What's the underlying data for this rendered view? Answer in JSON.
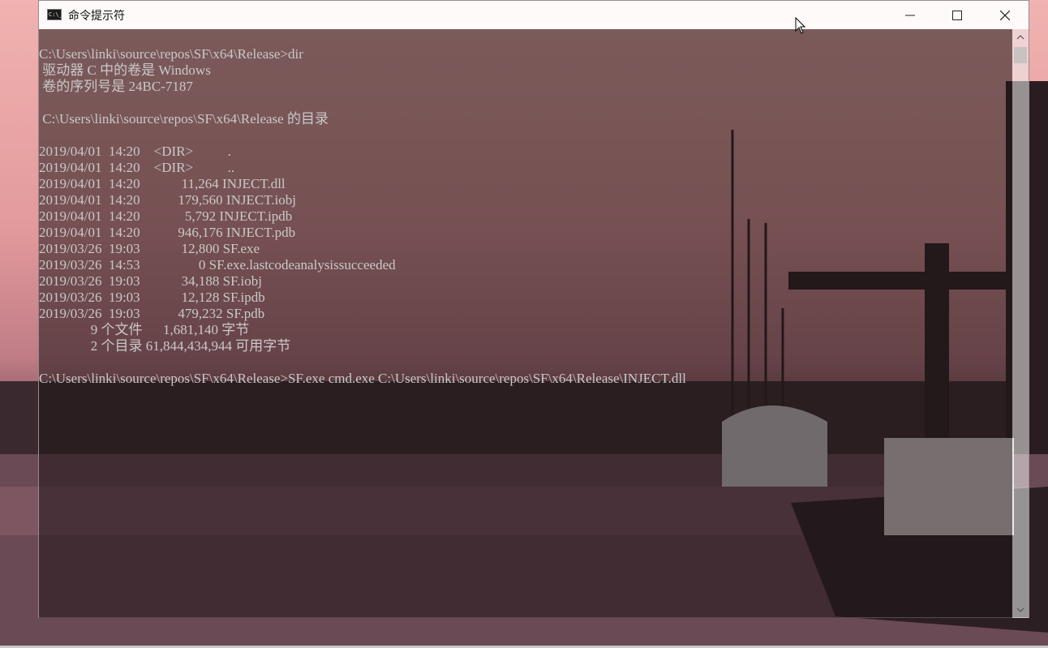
{
  "window": {
    "title": "命令提示符",
    "icon": "cmd-icon",
    "icon_text": "C:\\_"
  },
  "controls": {
    "minimize_icon": "minimize-icon",
    "maximize_icon": "maximize-icon",
    "close_icon": "close-icon"
  },
  "console": {
    "lines": [
      "C:\\Users\\linki\\source\\repos\\SF\\x64\\Release>dir",
      " 驱动器 C 中的卷是 Windows",
      " 卷的序列号是 24BC-7187",
      "",
      " C:\\Users\\linki\\source\\repos\\SF\\x64\\Release 的目录",
      "",
      "2019/04/01  14:20    <DIR>          .",
      "2019/04/01  14:20    <DIR>          ..",
      "2019/04/01  14:20            11,264 INJECT.dll",
      "2019/04/01  14:20           179,560 INJECT.iobj",
      "2019/04/01  14:20             5,792 INJECT.ipdb",
      "2019/04/01  14:20           946,176 INJECT.pdb",
      "2019/03/26  19:03            12,800 SF.exe",
      "2019/03/26  14:53                 0 SF.exe.lastcodeanalysissucceeded",
      "2019/03/26  19:03            34,188 SF.iobj",
      "2019/03/26  19:03            12,128 SF.ipdb",
      "2019/03/26  19:03           479,232 SF.pdb",
      "               9 个文件      1,681,140 字节",
      "               2 个目录 61,844,434,944 可用字节",
      "",
      "C:\\Users\\linki\\source\\repos\\SF\\x64\\Release>SF.exe cmd.exe C:\\Users\\linki\\source\\repos\\SF\\x64\\Release\\INJECT.dll"
    ]
  },
  "scrollbar": {
    "up_icon": "scroll-up-arrow-icon",
    "down_icon": "scroll-down-arrow-icon",
    "position": 0
  },
  "pointer": {
    "icon": "mouse-pointer-icon"
  }
}
